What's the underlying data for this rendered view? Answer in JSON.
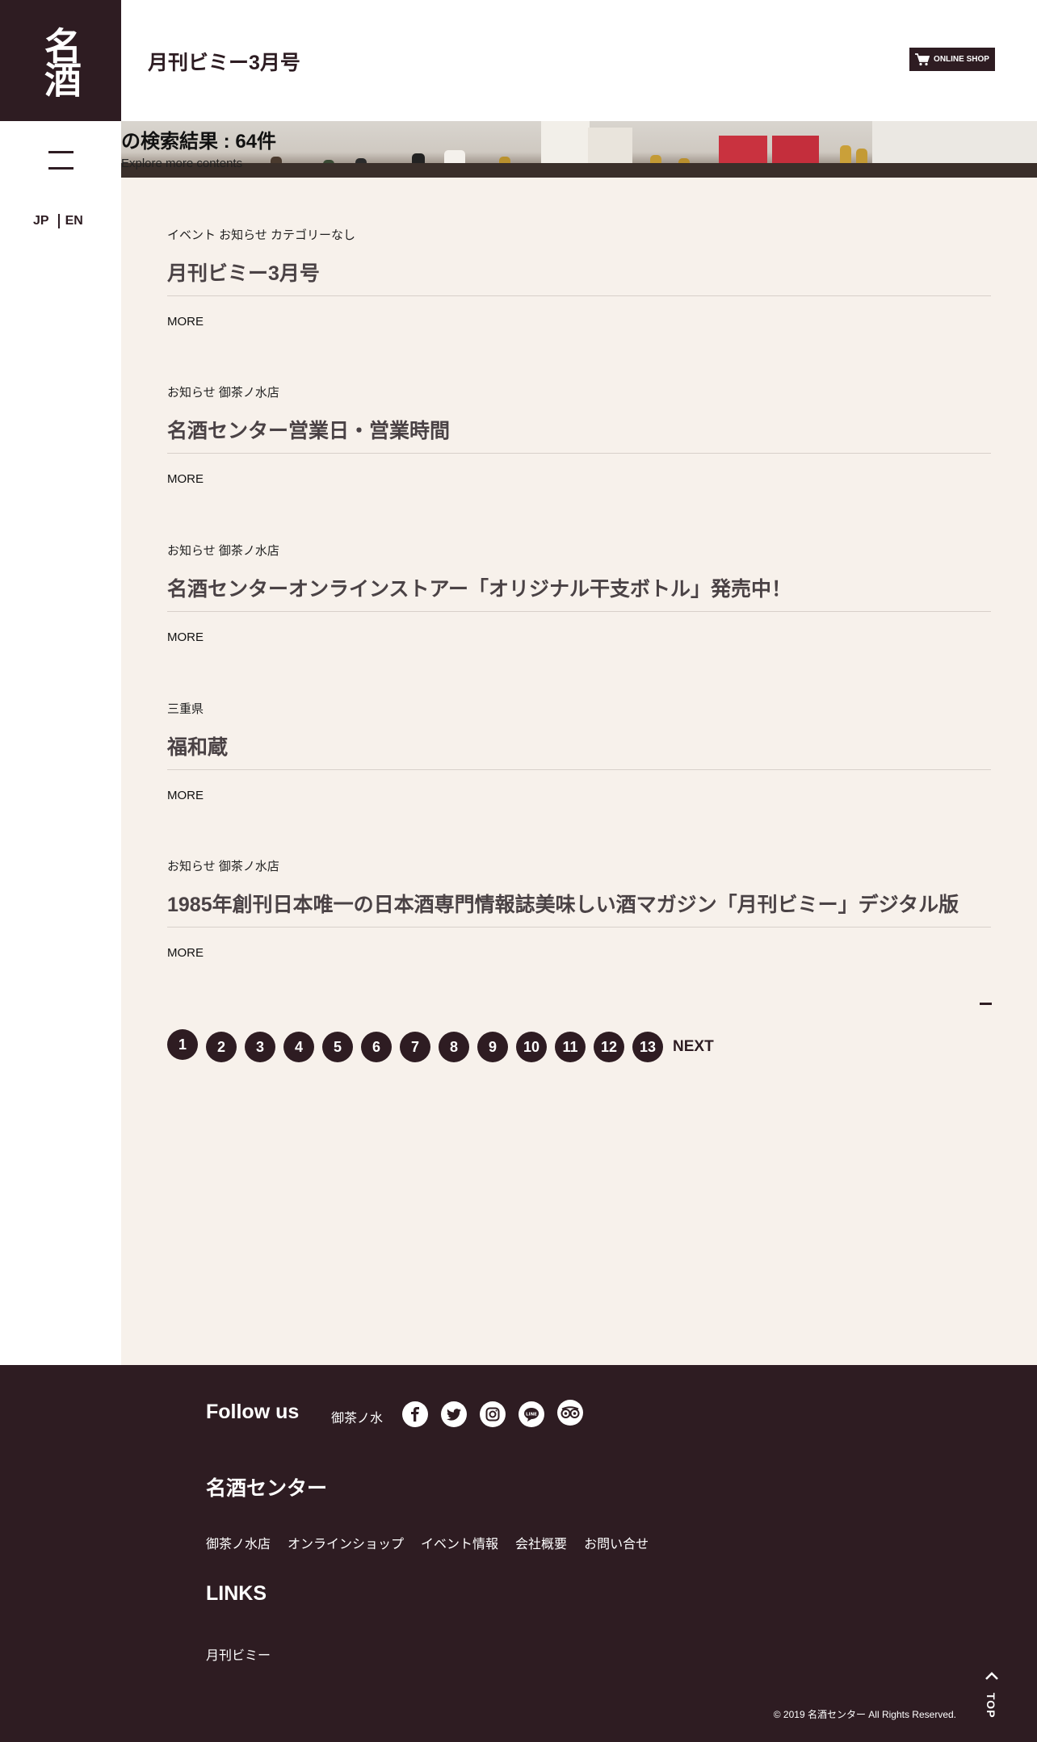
{
  "logo": {
    "text": "名酒センター",
    "glyphs": "名酒"
  },
  "header": {
    "title": "月刊ビミー3月号",
    "online_shop": "ONLINE SHOP"
  },
  "sidebar": {
    "lang_jp": "JP",
    "lang_en": "EN"
  },
  "hero": {
    "title": "の検索結果 : 64件",
    "subtitle": "Explore more contents"
  },
  "articles": [
    {
      "categories": "イベント お知らせ カテゴリーなし",
      "title": "月刊ビミー3月号",
      "more": "MORE"
    },
    {
      "categories": "お知らせ 御茶ノ水店",
      "title": "名酒センター営業日・営業時間",
      "more": "MORE"
    },
    {
      "categories": "お知らせ 御茶ノ水店",
      "title": "名酒センターオンラインストアー「オリジナル干支ボトル」発売中！",
      "more": "MORE"
    },
    {
      "categories": "三重県",
      "title": "福和蔵",
      "more": "MORE"
    },
    {
      "categories": "お知らせ 御茶ノ水店",
      "title": "1985年創刊日本唯一の日本酒専門情報誌美味しい酒マガジン「月刊ビミー」デジタル版",
      "more": "MORE"
    }
  ],
  "pagination": {
    "pages": [
      "1",
      "2",
      "3",
      "4",
      "5",
      "6",
      "7",
      "8",
      "9",
      "10",
      "11",
      "12",
      "13"
    ],
    "current": "1",
    "next": "NEXT"
  },
  "footer": {
    "follow_us": "Follow us",
    "store_label": "御茶ノ水",
    "social_icons": [
      "facebook-icon",
      "twitter-icon",
      "instagram-icon",
      "line-icon",
      "tripadvisor-icon"
    ],
    "brand_heading": "名酒センター",
    "nav": [
      "御茶ノ水店",
      "オンラインショップ",
      "イベント情報",
      "会社概要",
      "お問い合せ"
    ],
    "links_heading": "LINKS",
    "links": [
      "月刊ビミー"
    ],
    "copyright": "© 2019 名酒センター All Rights Reserved.",
    "top": "TOP"
  },
  "colors": {
    "brand": "#2e1c22",
    "content_bg": "#f7f1eb"
  }
}
